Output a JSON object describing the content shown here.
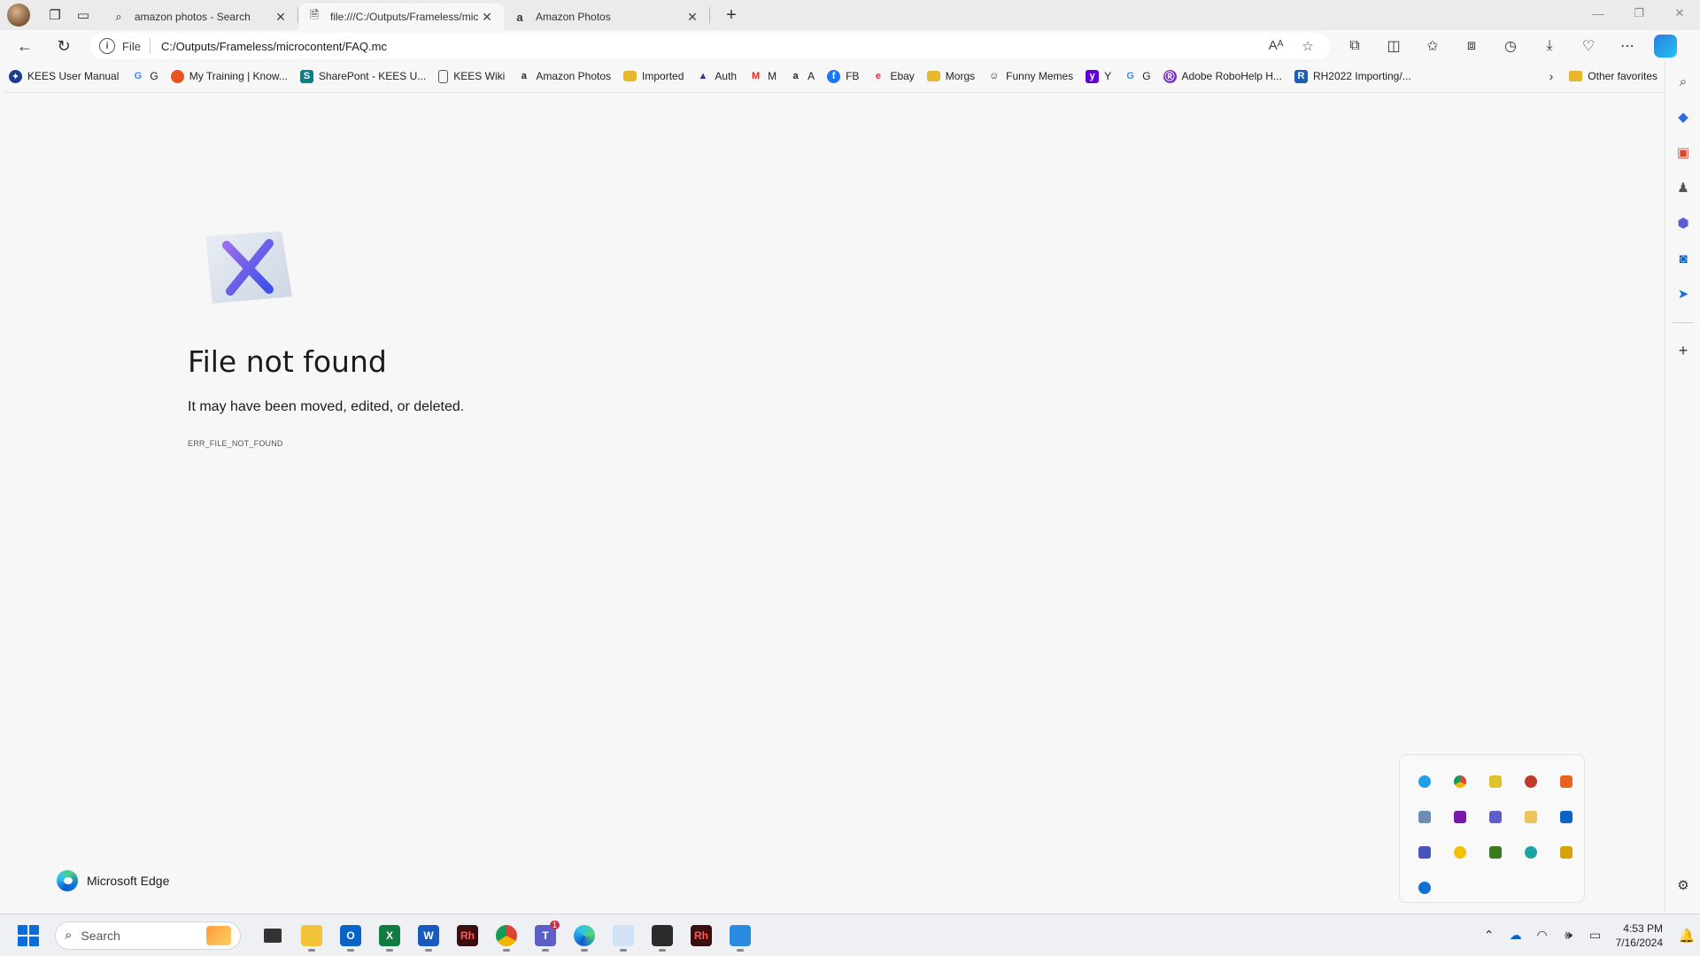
{
  "tabs": [
    {
      "label": "amazon photos - Search",
      "icon": "search-icon",
      "active": false
    },
    {
      "label": "file:///C:/Outputs/Frameless/mic",
      "icon": "document-icon",
      "active": true
    },
    {
      "label": "Amazon Photos",
      "icon": "amazon-icon",
      "active": false
    }
  ],
  "new_tab_glyph": "+",
  "address": {
    "scheme_label": "File",
    "url": "C:/Outputs/Frameless/microcontent/FAQ.mc"
  },
  "favorites": [
    {
      "label": "KEES User Manual",
      "icon": "kees-icon",
      "color": "#1a3d8f"
    },
    {
      "label": "G",
      "icon": "google-icon",
      "color": "#4285f4"
    },
    {
      "label": "My Training | Know...",
      "icon": "training-icon",
      "color": "#e8541e"
    },
    {
      "label": "SharePont - KEES U...",
      "icon": "sharepoint-icon",
      "color": "#038387"
    },
    {
      "label": "KEES Wiki",
      "icon": "page-icon",
      "color": "#555555"
    },
    {
      "label": "Amazon Photos",
      "icon": "amazon-icon",
      "color": "#222222"
    },
    {
      "label": "Imported",
      "icon": "folder-icon",
      "color": "#e8b730"
    },
    {
      "label": "Auth",
      "icon": "auth-icon",
      "color": "#2d3a8c"
    },
    {
      "label": "M",
      "icon": "gmail-icon",
      "color": "#d93025"
    },
    {
      "label": "A",
      "icon": "amazon-icon",
      "color": "#222222"
    },
    {
      "label": "FB",
      "icon": "facebook-icon",
      "color": "#1877f2"
    },
    {
      "label": "Ebay",
      "icon": "ebay-icon",
      "color": "#e53238"
    },
    {
      "label": "Morgs",
      "icon": "folder-icon",
      "color": "#e8b730"
    },
    {
      "label": "Funny Memes",
      "icon": "memes-icon",
      "color": "#333333"
    },
    {
      "label": "Y",
      "icon": "yahoo-icon",
      "color": "#6001d2"
    },
    {
      "label": "G",
      "icon": "google-icon",
      "color": "#4285f4"
    },
    {
      "label": "Adobe RoboHelp H...",
      "icon": "robohelp-icon",
      "color": "#7b2fbf"
    },
    {
      "label": "RH2022 Importing/...",
      "icon": "rh-icon",
      "color": "#1a5fb4"
    }
  ],
  "other_favorites": "Other favorites",
  "error": {
    "title": "File not found",
    "message": "It may have been moved, edited, or deleted.",
    "code": "ERR_FILE_NOT_FOUND"
  },
  "brand": "Microsoft Edge",
  "taskbar": {
    "search_placeholder": "Search",
    "time": "4:53 PM",
    "date": "7/16/2024",
    "teams_badge": "1"
  }
}
